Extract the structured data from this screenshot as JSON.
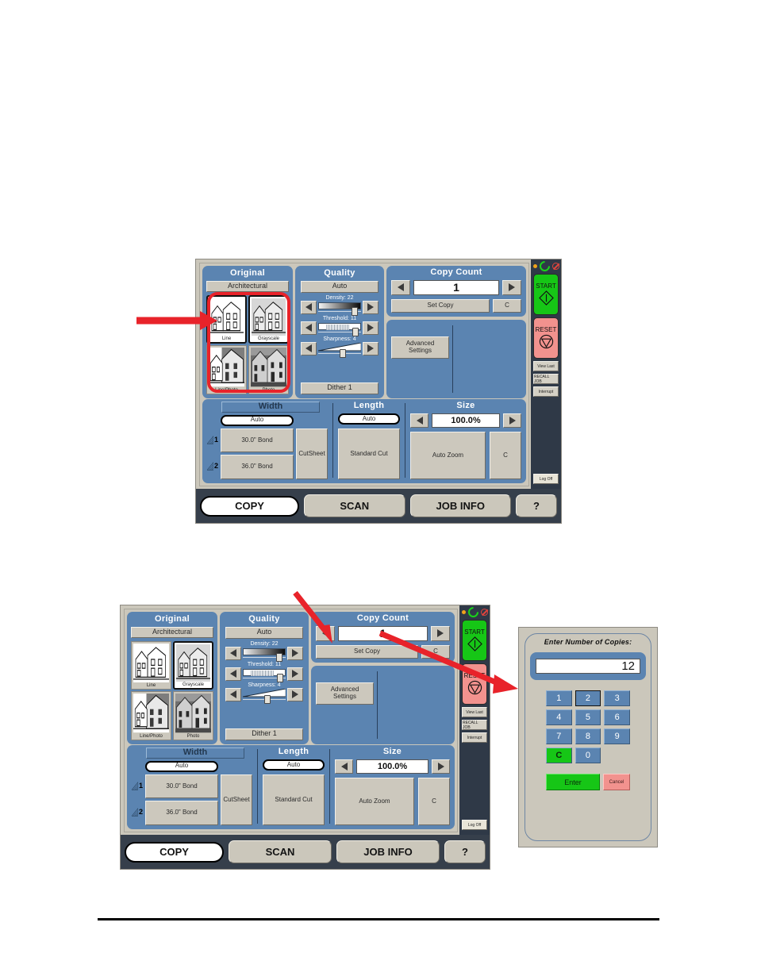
{
  "document": {
    "accent_red": "#e8232a",
    "panel_blue": "#5b84b1",
    "frame_grey": "#cbc7bb",
    "tabbar_dark": "#363f4b",
    "start_green": "#16c616",
    "reset_red": "#f2928e"
  },
  "panel": {
    "original": {
      "title": "Original",
      "mode_label": "Architectural",
      "thumbs": [
        {
          "caption": "Line",
          "selected": false
        },
        {
          "caption": "Grayscale",
          "selected": true
        },
        {
          "caption": "Line/Photo",
          "selected": false
        },
        {
          "caption": "Photo",
          "selected": false
        }
      ]
    },
    "quality": {
      "title": "Quality",
      "auto_label": "Auto",
      "sliders": [
        {
          "label": "Density: 22",
          "value": 22,
          "knob_pct": 78
        },
        {
          "label": "Threshold: 11",
          "value": 11,
          "knob_pct": 80
        },
        {
          "label": "Sharpness: 4",
          "value": 4,
          "knob_pct": 50
        }
      ],
      "dither_label": "Dither 1"
    },
    "copy_count": {
      "title": "Copy Count",
      "value": "1",
      "set_copy_label": "Set Copy",
      "clear_label": "C"
    },
    "advanced": {
      "label_line1": "Advanced",
      "label_line2": "Settings"
    },
    "width": {
      "title": "Width",
      "auto_label": "Auto",
      "roll1_num": "1",
      "roll1_label": "30.0\" Bond",
      "roll2_num": "2",
      "roll2_label": "36.0\" Bond",
      "cutsheet_label": "CutSheet"
    },
    "length": {
      "title": "Length",
      "auto_label": "Auto",
      "standard_cut_label": "Standard Cut"
    },
    "size": {
      "title": "Size",
      "value": "100.0%",
      "auto_zoom_label": "Auto Zoom",
      "clear_label": "C"
    },
    "status_column": {
      "start_label": "START",
      "reset_label": "RESET",
      "buttons": [
        "View Last",
        "RECALL JOB",
        "Interrupt"
      ],
      "logoff_label": "Log Off"
    },
    "tabs": [
      {
        "label": "COPY",
        "active": true
      },
      {
        "label": "SCAN",
        "active": false
      },
      {
        "label": "JOB INFO",
        "active": false
      },
      {
        "label": "?",
        "active": false
      }
    ]
  },
  "keypad": {
    "title": "Enter Number of Copies:",
    "display_value": "12",
    "keys": [
      {
        "label": "1",
        "selected": false
      },
      {
        "label": "2",
        "selected": true
      },
      {
        "label": "3",
        "selected": false
      },
      {
        "label": "4",
        "selected": false
      },
      {
        "label": "5",
        "selected": false
      },
      {
        "label": "6",
        "selected": false
      },
      {
        "label": "7",
        "selected": false
      },
      {
        "label": "8",
        "selected": false
      },
      {
        "label": "9",
        "selected": false
      },
      {
        "label": "C",
        "selected": false
      },
      {
        "label": "0",
        "selected": false
      }
    ],
    "enter_label": "Enter",
    "cancel_label": "Cancel"
  }
}
